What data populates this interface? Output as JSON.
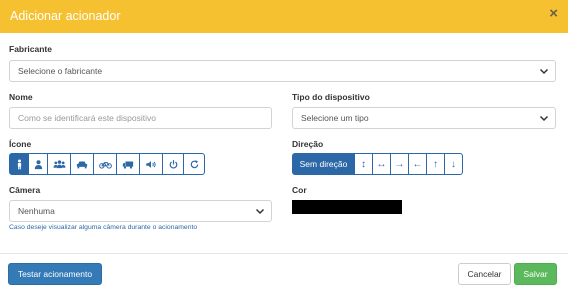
{
  "modal": {
    "title": "Adicionar acionador",
    "close_label": "×"
  },
  "form": {
    "fabricante": {
      "label": "Fabricante",
      "value": "Selecione o fabricante"
    },
    "nome": {
      "label": "Nome",
      "placeholder": "Como se identificará este dispositivo"
    },
    "tipo": {
      "label": "Tipo do dispositivo",
      "value": "Selecione um tipo"
    },
    "icone": {
      "label": "Ícone",
      "icons": [
        "person-icon",
        "user-icon",
        "group-icon",
        "car-icon",
        "bike-icon",
        "truck-icon",
        "speaker-icon",
        "power-icon",
        "refresh-icon"
      ],
      "selected": "person-icon"
    },
    "direcao": {
      "label": "Direção",
      "options": [
        "Sem direção",
        "↕",
        "↔",
        "→",
        "←",
        "↑",
        "↓"
      ],
      "selected": "Sem direção"
    },
    "camera": {
      "label": "Câmera",
      "value": "Nenhuma",
      "hint": "Caso deseje visualizar alguma câmera durante o acionamento"
    },
    "cor": {
      "label": "Cor",
      "value": "#000000"
    }
  },
  "footer": {
    "test_label": "Testar acionamento",
    "cancel_label": "Cancelar",
    "save_label": "Salvar"
  },
  "colors": {
    "header": "#f6c131",
    "primary": "#2c68a7",
    "success": "#5cb85c"
  }
}
